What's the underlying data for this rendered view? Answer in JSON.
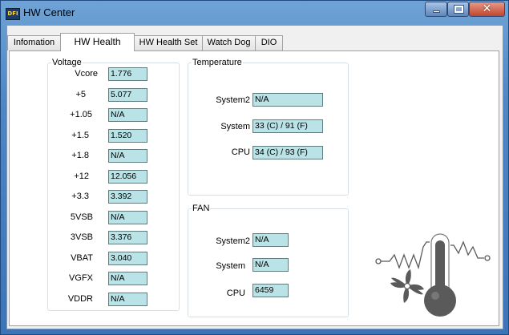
{
  "window": {
    "title": "HW Center",
    "app_icon_text": "DFI",
    "close_glyph": "✕"
  },
  "tabs": [
    {
      "label": "Infomation",
      "active": false
    },
    {
      "label": "HW Health",
      "active": true
    },
    {
      "label": "HW Health Set",
      "active": false
    },
    {
      "label": "Watch Dog",
      "active": false
    },
    {
      "label": "DIO",
      "active": false
    }
  ],
  "voltage": {
    "legend": "Voltage",
    "rows": [
      {
        "label": "Vcore",
        "value": "1.776"
      },
      {
        "label": "+5",
        "value": "5.077"
      },
      {
        "label": "+1.05",
        "value": "N/A"
      },
      {
        "label": "+1.5",
        "value": "1.520"
      },
      {
        "label": "+1.8",
        "value": "N/A"
      },
      {
        "label": "+12",
        "value": "12.056"
      },
      {
        "label": "+3.3",
        "value": "3.392"
      },
      {
        "label": "5VSB",
        "value": "N/A"
      },
      {
        "label": "3VSB",
        "value": "3.376"
      },
      {
        "label": "VBAT",
        "value": "3.040"
      },
      {
        "label": "VGFX",
        "value": "N/A"
      },
      {
        "label": "VDDR",
        "value": "N/A"
      }
    ]
  },
  "temperature": {
    "legend": "Temperature",
    "rows": [
      {
        "label": "System2",
        "value": "N/A"
      },
      {
        "label": "System",
        "value": "33 (C) / 91 (F)"
      },
      {
        "label": "CPU",
        "value": "34 (C) / 93 (F)"
      }
    ]
  },
  "fan": {
    "legend": "FAN",
    "rows": [
      {
        "label": "System2",
        "value": "N/A"
      },
      {
        "label": "System",
        "value": "N/A"
      },
      {
        "label": "CPU",
        "value": "6459"
      }
    ]
  },
  "colors": {
    "field_bg": "#b9e3e6",
    "field_border": "#5f7c7e",
    "titlebar": "#4f86c4"
  },
  "icons": {
    "illustration": "fan-thermometer-resistor-icon"
  }
}
